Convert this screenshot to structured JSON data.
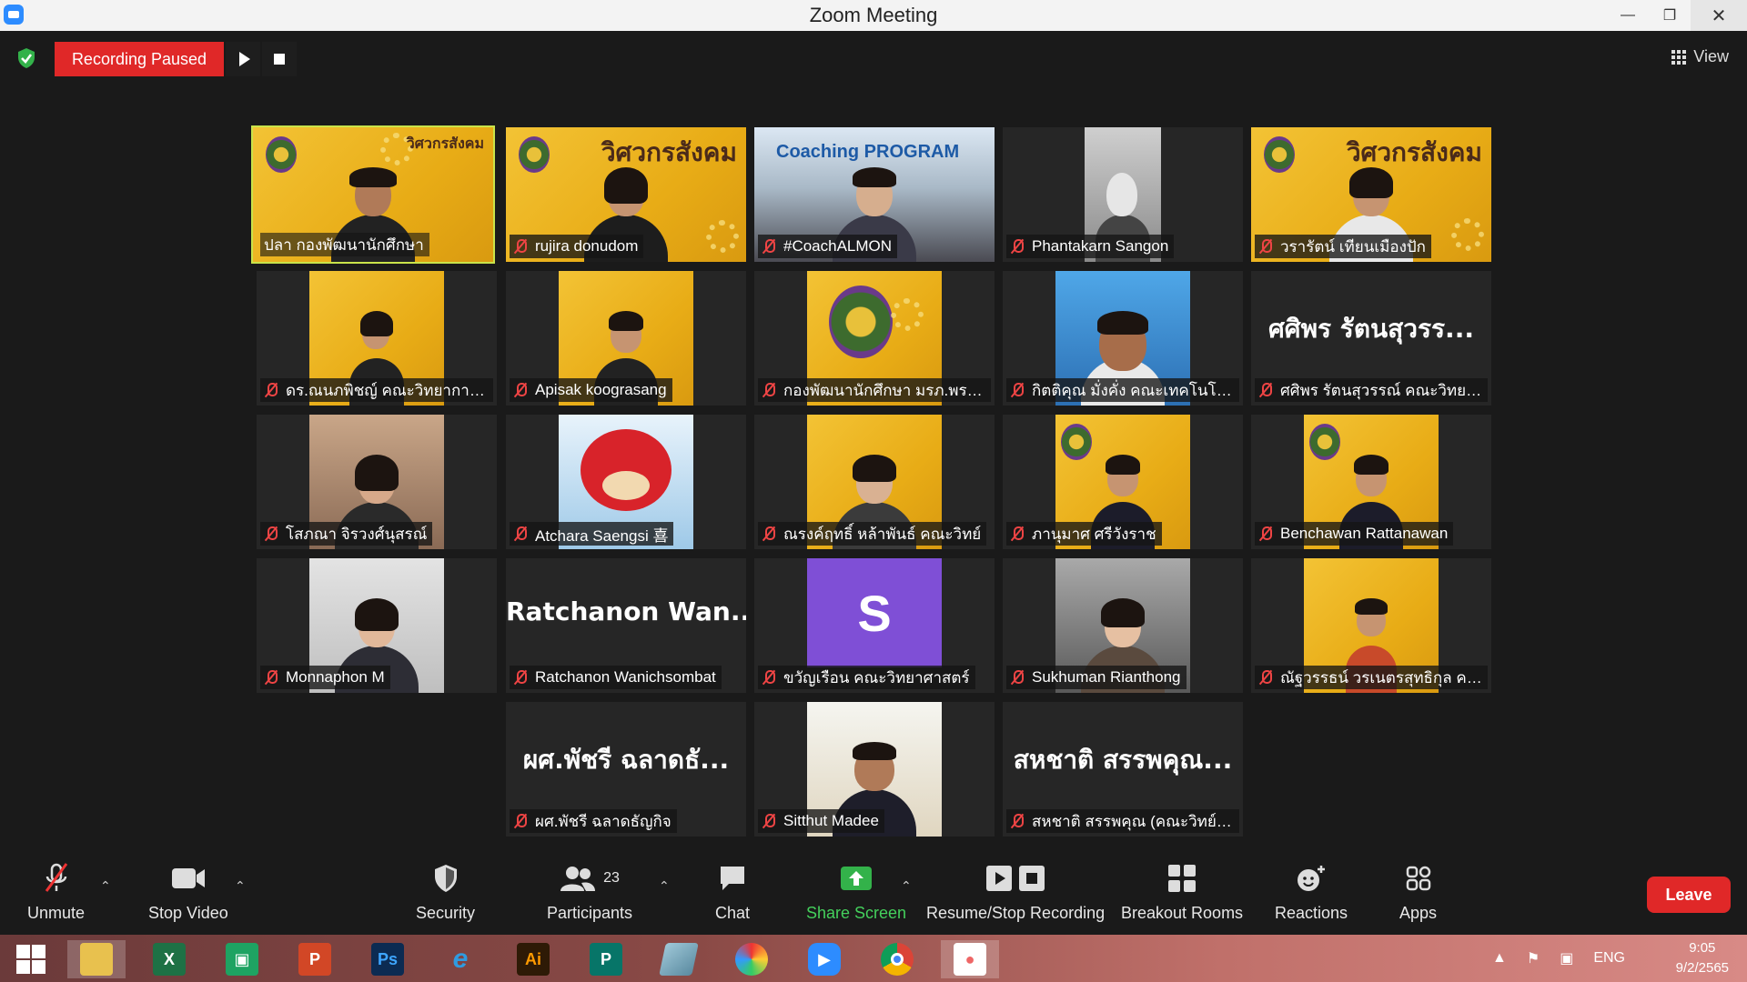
{
  "window": {
    "title": "Zoom Meeting"
  },
  "recording": {
    "status": "Recording Paused"
  },
  "view": {
    "label": "View"
  },
  "tiles": [
    {
      "name": "ปลา กองพัฒนานักศึกษา",
      "muted": false,
      "active": true
    },
    {
      "name": "rujira donudom",
      "muted": true
    },
    {
      "name": "#CoachALMON",
      "muted": true
    },
    {
      "name": "Phantakarn Sangon",
      "muted": true
    },
    {
      "name": "วรารัตน์ เทียนเมืองปัก",
      "muted": true
    },
    {
      "name": "ดร.ณนภพิชญ์ คณะวิทยาการจัด...",
      "muted": true
    },
    {
      "name": "Apisak koograsang",
      "muted": true
    },
    {
      "name": "กองพัฒนานักศึกษา มรภ.พระนคร",
      "muted": true
    },
    {
      "name": "กิตติคุณ มั่งคั่ง คณะเทคโนโลยีอุ...",
      "muted": true
    },
    {
      "name": "ศศิพร รัตนสุวรรณ์ คณะวิทยาศ...",
      "muted": true,
      "big_name": "ศศิพร รัตนสุวรร..."
    },
    {
      "name": "โสภณา จิรวงศ์นุสรณ์",
      "muted": true
    },
    {
      "name": "Atchara Saengsi 喜",
      "muted": true
    },
    {
      "name": "ณรงค์ฤทธิ์ หล้าพันธ์ คณะวิทย์",
      "muted": true
    },
    {
      "name": "ภานุมาศ ศรีวังราช",
      "muted": true
    },
    {
      "name": "Benchawan Rattanawan",
      "muted": true
    },
    {
      "name": "Monnaphon M",
      "muted": true
    },
    {
      "name": "Ratchanon Wanichsombat",
      "muted": true,
      "big_name": "Ratchanon Wan..."
    },
    {
      "name": "ขวัญเรือน คณะวิทยาศาสตร์",
      "muted": true,
      "avatar_letter": "S"
    },
    {
      "name": "Sukhuman Rianthong",
      "muted": true
    },
    {
      "name": "ณัฐวรรธน์ วรเนตรสุทธิกุล คณะเ...",
      "muted": true
    },
    {
      "name": "ผศ.พัชรี ฉลาดธัญกิจ",
      "muted": true,
      "big_name": "ผศ.พัชรี ฉลาดธั..."
    },
    {
      "name": "Sitthut Madee",
      "muted": true
    },
    {
      "name": "สหชาติ สรรพคุณ (คณะวิทย์ฯ )",
      "muted": true,
      "big_name": "สหชาติ สรรพคุณ..."
    }
  ],
  "banner": {
    "text": "วิศวกรสังคม",
    "coach_title": "Coaching PROGRAM"
  },
  "toolbar": {
    "unmute": "Unmute",
    "stop_video": "Stop Video",
    "security": "Security",
    "participants": "Participants",
    "participants_count": "23",
    "chat": "Chat",
    "share_screen": "Share Screen",
    "resume_stop_recording": "Resume/Stop Recording",
    "breakout_rooms": "Breakout Rooms",
    "reactions": "Reactions",
    "apps": "Apps",
    "leave": "Leave"
  },
  "taskbar": {
    "apps": [
      "start",
      "file-explorer",
      "excel",
      "store",
      "powerpoint",
      "photoshop",
      "internet-explorer",
      "illustrator",
      "publisher",
      "unknown-app",
      "photoscape",
      "zoom",
      "chrome",
      "paint-3d"
    ],
    "language": "ENG",
    "time": "9:05",
    "date": "9/2/2565"
  },
  "colors": {
    "accent_red": "#e02828",
    "active_border": "#c9e34a",
    "share_green": "#44d05c",
    "banner_yellow": "#f3c335"
  }
}
